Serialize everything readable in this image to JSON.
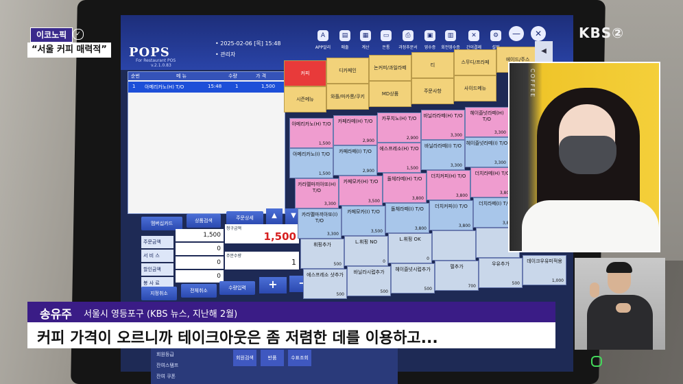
{
  "overlay": {
    "channel_logo": "KBS②",
    "segment_tag": "이코노픽",
    "segment_title": "“서울 커피 매력적”",
    "speaker_name": "송유주",
    "speaker_info": "서울시 영등포구 (KBS 뉴스, 지난해 2월)",
    "caption": "커피 가격이 오르니까 테이크아웃은 좀 저렴한 데를 이용하고..."
  },
  "pos": {
    "logo": "POPS",
    "logo_sub": "For Restaurant POS",
    "version": "v.2.1.0.83",
    "date": "• 2025-02-06 [목]  15:48",
    "user": "• 관리자",
    "toolbar": [
      "APP알리",
      "매출",
      "계산",
      "돈통",
      "과정추문서",
      "영수증",
      "회전영수증",
      "간이결제",
      "설정"
    ],
    "order_headers": [
      "순번",
      "메 뉴",
      "수량",
      "가 격"
    ],
    "order_row": {
      "no": "1",
      "name": "아메리카노(H) T/O",
      "time": "15:48",
      "qty": "1",
      "price": "1,500"
    },
    "left_buttons": [
      "멤버십카드",
      "상품검색",
      "주문상세"
    ],
    "fields": [
      {
        "label": "주문금액",
        "value": "1,500"
      },
      {
        "label": "서 비 스",
        "value": "0"
      },
      {
        "label": "할인금액",
        "value": "0"
      },
      {
        "label": "봉 사 료",
        "value": "0"
      }
    ],
    "payment_label": "청구금액",
    "payment_value": "1,500",
    "qty_label": "주문수량",
    "qty_value": "1",
    "action_buttons": [
      "지정취소",
      "전체취소",
      "수량입력"
    ],
    "plus": "+",
    "minus": "−",
    "categories": [
      "커피",
      "디카페인",
      "논커피/과일라떼",
      "티",
      "스무디/프라페",
      "에이드/주스",
      "시즌메뉴",
      "와플/마카롱/쿠키",
      "MD상품",
      "주문사항",
      "사이드메뉴"
    ],
    "menu_items": [
      {
        "name": "아메리카노(H) T/O",
        "price": "1,500"
      },
      {
        "name": "카페라떼(H) T/O",
        "price": "2,900"
      },
      {
        "name": "카푸치노(H) T/O",
        "price": "2,900"
      },
      {
        "name": "바닐라라떼(H) T/O",
        "price": "3,300"
      },
      {
        "name": "헤이즐넛라떼(H) T/O",
        "price": "3,300"
      },
      {
        "name": "아메리카노(I) T/O",
        "price": "1,500"
      },
      {
        "name": "카페라떼(I) T/O",
        "price": "2,900"
      },
      {
        "name": "에스프레소(H) T/O",
        "price": "1,500"
      },
      {
        "name": "바닐라라떼(I) T/O",
        "price": "3,300"
      },
      {
        "name": "헤이즐넛라떼(I) T/O",
        "price": "3,300"
      },
      {
        "name": "카라멜마끼아또(H) T/O",
        "price": "3,300"
      },
      {
        "name": "카페모카(H) T/O",
        "price": "3,500"
      },
      {
        "name": "돌체라떼(H) T/O",
        "price": "3,800"
      },
      {
        "name": "더치커피(H) T/O",
        "price": "3,800"
      },
      {
        "name": "더치라떼(H) T/O",
        "price": "3,800"
      },
      {
        "name": "카라멜마끼아또(I) T/O",
        "price": "3,300"
      },
      {
        "name": "카페모카(I) T/O",
        "price": "3,500"
      },
      {
        "name": "돌체라떼(I) T/O",
        "price": "3,800"
      },
      {
        "name": "더치커피(I) T/O",
        "price": "3,800"
      },
      {
        "name": "더치라떼(I) T/O",
        "price": "3,800"
      },
      {
        "name": "휘핑추가",
        "price": "500"
      },
      {
        "name": "L.휘핑 NO",
        "price": "0"
      },
      {
        "name": "L.휘핑 OK",
        "price": "0"
      },
      {
        "name": "",
        "price": ""
      },
      {
        "name": "",
        "price": ""
      },
      {
        "name": "에스프레소 샷추가",
        "price": "500"
      },
      {
        "name": "바닐라시럽추가",
        "price": "500"
      },
      {
        "name": "헤이즐넛시럽추가",
        "price": "500"
      },
      {
        "name": "펄추가",
        "price": "700"
      },
      {
        "name": "우유추가",
        "price": "500"
      },
      {
        "name": "데이크우유미적용",
        "price": "1,000"
      }
    ],
    "bottom_labels": [
      "회원등급",
      "잔여스탬프",
      "잔여 쿠폰"
    ],
    "bottom_buttons": [
      "회원검색",
      "반품",
      "수표조회"
    ]
  }
}
